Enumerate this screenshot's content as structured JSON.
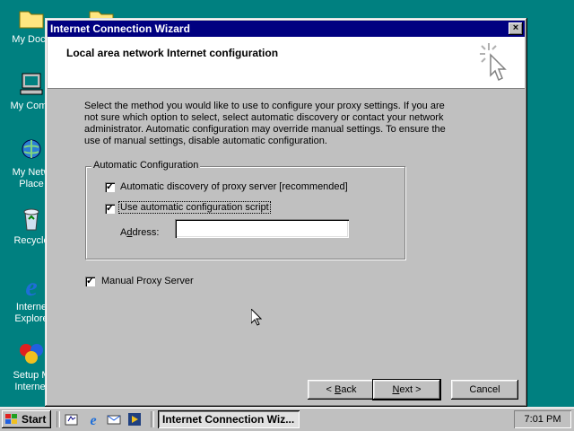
{
  "desktop": {
    "icons": [
      {
        "label": "My Docu",
        "icon": "folder-icon"
      },
      {
        "label": "My Comp",
        "icon": "computer-icon"
      },
      {
        "label": "My Netw Place",
        "icon": "network-icon"
      },
      {
        "label": "Recycle",
        "icon": "recycle-bin-icon"
      },
      {
        "label": "Interne Explore",
        "icon": "ie-icon"
      },
      {
        "label": "Setup M Internet",
        "icon": "msn-icon"
      }
    ]
  },
  "window": {
    "title": "Internet Connection Wizard",
    "close_glyph": "×",
    "header_title": "Local area network Internet configuration",
    "description": "Select the method you would like to use to configure your proxy settings.  If you are not sure which option to select, select automatic discovery or contact your network administrator.  Automatic configuration may override manual settings.  To ensure the use of manual settings, disable automatic configuration.",
    "auto_group": {
      "label": "Automatic Configuration",
      "auto_discovery": {
        "label": "Automatic discovery of proxy server [recommended]",
        "checked": true
      },
      "auto_script": {
        "label": "Use automatic configuration script",
        "checked": true
      },
      "address_label_pre": "A",
      "address_label_ul": "d",
      "address_label_post": "dress:",
      "address_value": ""
    },
    "manual_proxy": {
      "label": "Manual Proxy Server",
      "checked": true
    },
    "buttons": {
      "back_pre": "< ",
      "back_ul": "B",
      "back_post": "ack",
      "next_ul": "N",
      "next_post": "ext >",
      "cancel": "Cancel"
    },
    "check_glyph": "✓"
  },
  "taskbar": {
    "start_label": "Start",
    "task_label": "Internet Connection Wiz...",
    "clock": "7:01 PM"
  }
}
